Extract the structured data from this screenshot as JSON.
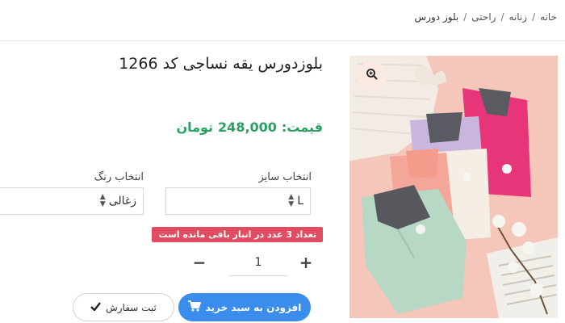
{
  "breadcrumb": {
    "items": [
      "خانه",
      "زنانه",
      "راحتی"
    ],
    "current": "بلوز دورس",
    "separator": "/"
  },
  "product": {
    "title": "بلوزدورس یقه نساجی کد 1266",
    "price_label": "قیمت:",
    "price_value": "248,000",
    "currency": "تومان",
    "image_icon": "zoom-in-icon"
  },
  "options": {
    "size_label": "انتخاب سایز",
    "size_value": "L",
    "color_label": "انتخاب رنگ",
    "color_value": "زغالی"
  },
  "stock": {
    "message": "تعداد 3 عدد در انبار باقی مانده است"
  },
  "quantity": {
    "value": "1",
    "minus": "−",
    "plus": "+"
  },
  "actions": {
    "add_to_cart": "افزودن به سبد خرید",
    "add_to_cart_icon": "cart-icon",
    "submit_order": "ثبت سفارش",
    "submit_order_icon": "check-icon"
  },
  "colors": {
    "price": "#2ba063",
    "primary_button": "#3b8ded",
    "stock_badge": "#e04d63"
  }
}
